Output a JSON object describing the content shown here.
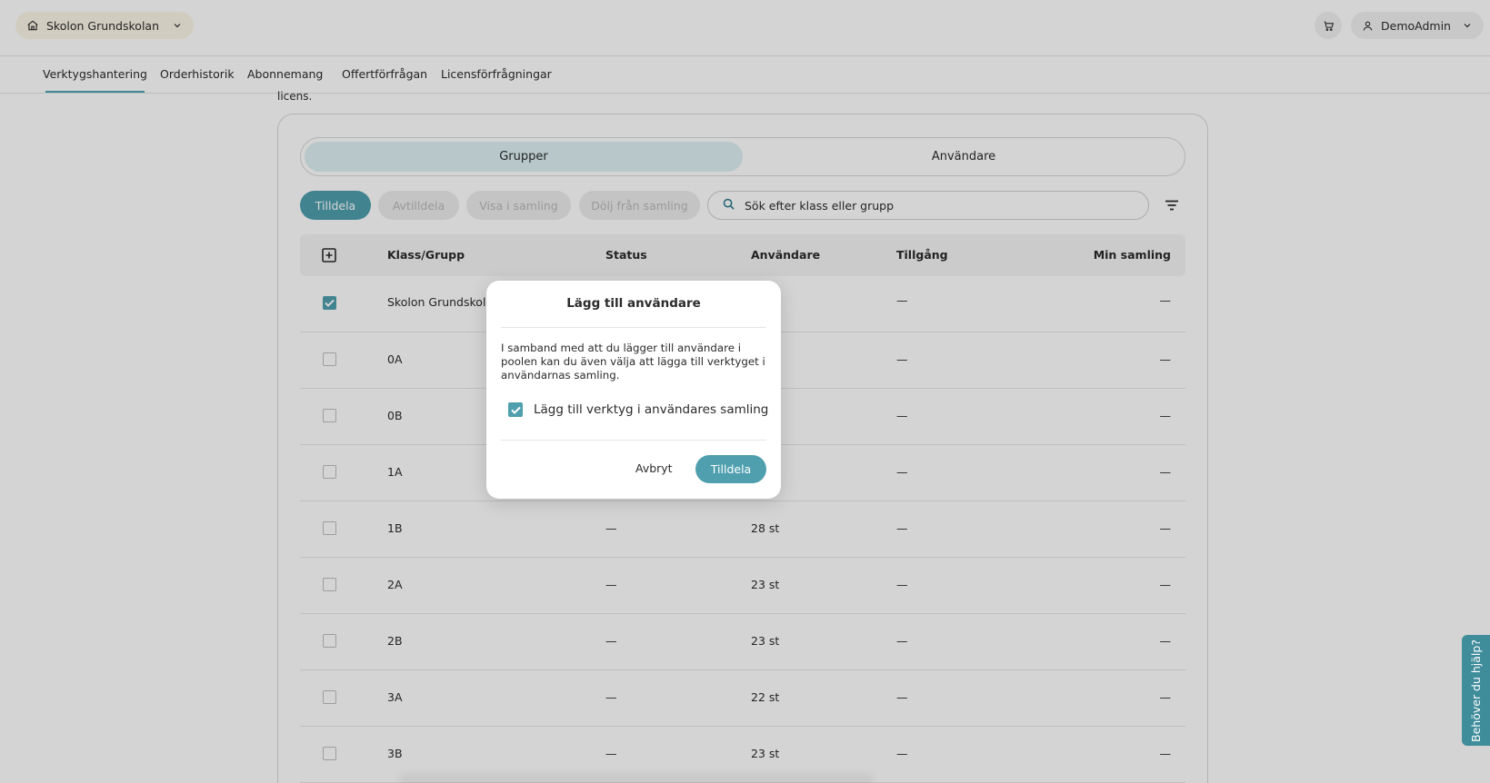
{
  "header": {
    "school_name": "Skolon Grundskolan",
    "user_name": "DemoAdmin"
  },
  "nav": {
    "tabs": [
      {
        "label": "Verktygshantering",
        "active": true
      },
      {
        "label": "Orderhistorik"
      },
      {
        "label": "Abonnemang"
      },
      {
        "label": "Offertförfrågan"
      },
      {
        "label": "Licensförfrågningar"
      }
    ]
  },
  "main": {
    "partial_text": "licens.",
    "segments": [
      "Grupper",
      "Användare"
    ],
    "active_segment": "Grupper",
    "actions": {
      "assign": "Tilldela",
      "unassign": "Avtilldela",
      "show_in_collection": "Visa i samling",
      "hide_from_collection": "Dölj från samling"
    },
    "search": {
      "placeholder": "Sök efter klass eller grupp"
    },
    "table": {
      "headers": {
        "group": "Klass/Grupp",
        "status": "Status",
        "users": "Användare",
        "access": "Tillgång",
        "my_collection": "Min samling"
      },
      "rows": [
        {
          "name": "Skolon Grundskolan",
          "status": "",
          "users": "",
          "access": "—",
          "collection": "—",
          "checked": true
        },
        {
          "name": "0A",
          "status": "",
          "users": "",
          "access": "—",
          "collection": "—",
          "checked": false
        },
        {
          "name": "0B",
          "status": "",
          "users": "",
          "access": "—",
          "collection": "—",
          "checked": false
        },
        {
          "name": "1A",
          "status": "",
          "users": "",
          "access": "—",
          "collection": "—",
          "checked": false
        },
        {
          "name": "1B",
          "status": "—",
          "users": "28 st",
          "access": "—",
          "collection": "—",
          "checked": false
        },
        {
          "name": "2A",
          "status": "—",
          "users": "23 st",
          "access": "—",
          "collection": "—",
          "checked": false
        },
        {
          "name": "2B",
          "status": "—",
          "users": "23 st",
          "access": "—",
          "collection": "—",
          "checked": false
        },
        {
          "name": "3A",
          "status": "—",
          "users": "22 st",
          "access": "—",
          "collection": "—",
          "checked": false
        },
        {
          "name": "3B",
          "status": "—",
          "users": "23 st",
          "access": "—",
          "collection": "—",
          "checked": false
        }
      ]
    }
  },
  "modal": {
    "title": "Lägg till användare",
    "body": "I samband med att du lägger till användare i poolen kan du även välja att lägga till verktyget i användarnas samling.",
    "checkbox_label": "Lägg till verktyg i användares samling",
    "checkbox_checked": true,
    "cancel": "Avbryt",
    "confirm": "Tilldela"
  },
  "help": {
    "label": "Behöver du hjälp?"
  },
  "colors": {
    "accent": "#4f9fae",
    "accent_light": "#dcf0f3",
    "help_tab": "#3f8c9b"
  }
}
